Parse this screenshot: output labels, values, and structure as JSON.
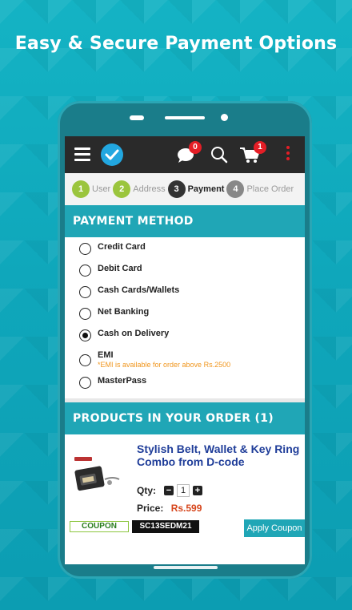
{
  "headline": "Easy & Secure Payment Options",
  "appbar": {
    "chat_badge": "0",
    "cart_badge": "1",
    "accent": "#e41e26"
  },
  "steps": [
    {
      "num": "1",
      "label": "User"
    },
    {
      "num": "2",
      "label": "Address"
    },
    {
      "num": "3",
      "label": "Payment"
    },
    {
      "num": "4",
      "label": "Place Order"
    }
  ],
  "payment": {
    "heading": "PAYMENT METHOD",
    "options": [
      {
        "label": "Credit Card"
      },
      {
        "label": "Debit Card"
      },
      {
        "label": "Cash Cards/Wallets"
      },
      {
        "label": "Net Banking"
      },
      {
        "label": "Cash on Delivery"
      },
      {
        "label": "EMI",
        "note": "*EMI is available for order above Rs.2500"
      },
      {
        "label": "MasterPass"
      }
    ],
    "selected": "Cash on Delivery"
  },
  "order": {
    "heading": "PRODUCTS IN YOUR ORDER (1)",
    "product": {
      "title": "Stylish Belt, Wallet & Key Ring Combo from D-code",
      "qty_label": "Qty:",
      "qty": "1",
      "price_label": "Price:",
      "price": "Rs.599",
      "minus": "−",
      "plus": "+"
    },
    "coupon_label": "COUPON",
    "coupon_code": "SC13SEDM21",
    "apply_label": "Apply Coupon"
  },
  "colors": {
    "brand": "#20a6b6",
    "done_step": "#9bc53d",
    "price": "#d6451b"
  }
}
